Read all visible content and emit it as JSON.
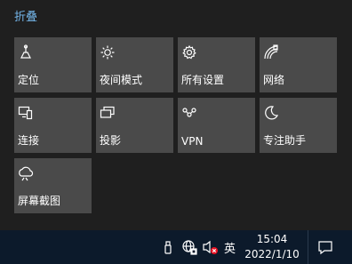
{
  "action_center": {
    "collapse_label": "折叠",
    "tiles": [
      {
        "label": "定位",
        "icon": "location-icon"
      },
      {
        "label": "夜间模式",
        "icon": "night-light-icon"
      },
      {
        "label": "所有设置",
        "icon": "settings-gear-icon"
      },
      {
        "label": "网络",
        "icon": "network-icon"
      },
      {
        "label": "连接",
        "icon": "connect-icon"
      },
      {
        "label": "投影",
        "icon": "project-icon"
      },
      {
        "label": "VPN",
        "icon": "vpn-icon"
      },
      {
        "label": "专注助手",
        "icon": "focus-assist-moon-icon"
      },
      {
        "label": "屏幕截图",
        "icon": "screen-snip-icon"
      }
    ]
  },
  "taskbar": {
    "ime_label": "英",
    "time": "15:04",
    "date": "2022/1/10",
    "tray_icons": [
      "usb-drive-icon",
      "globe-network-icon",
      "volume-muted-icon"
    ]
  },
  "colors": {
    "accent": "#74b6ea",
    "tile_bg": "#4a4a4a",
    "panel_bg": "#1f1f1f",
    "taskbar_bg": "#0c1a2b",
    "mute_badge": "#e81123"
  }
}
